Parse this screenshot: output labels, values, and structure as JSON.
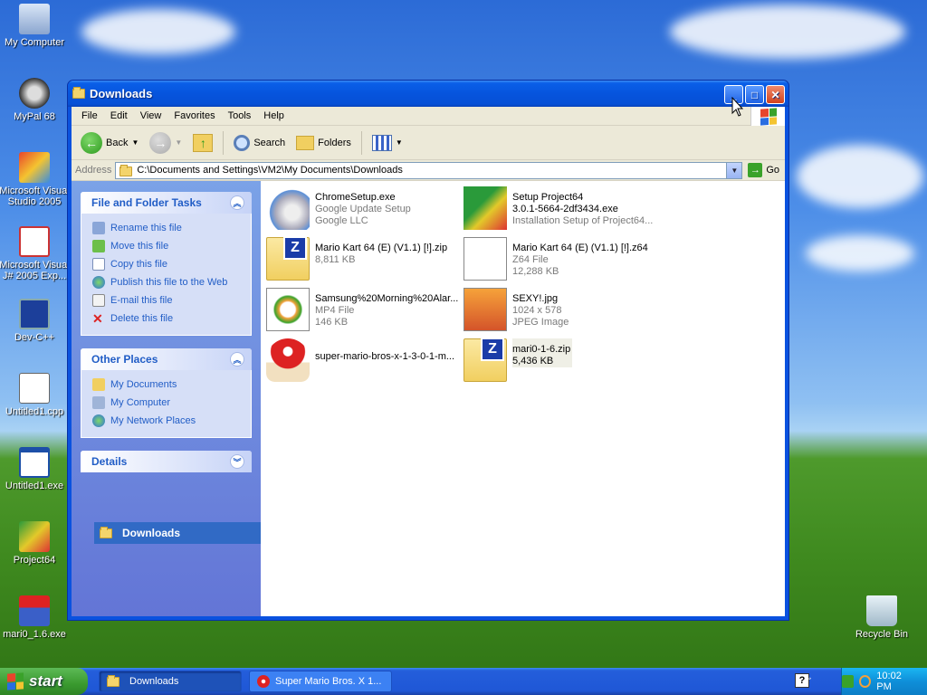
{
  "desktop": {
    "icons": [
      {
        "label": "My Computer"
      },
      {
        "label": "MyPal 68"
      },
      {
        "label": "Microsoft Visual Studio 2005"
      },
      {
        "label": "Microsoft Visual J# 2005 Exp..."
      },
      {
        "label": "Dev-C++"
      },
      {
        "label": "Untitled1.cpp"
      },
      {
        "label": "Untitled1.exe"
      },
      {
        "label": "Project64"
      },
      {
        "label": "mari0_1.6.exe"
      },
      {
        "label": "Recycle Bin"
      }
    ]
  },
  "window": {
    "title": "Downloads",
    "menu": [
      "File",
      "Edit",
      "View",
      "Favorites",
      "Tools",
      "Help"
    ],
    "toolbar": {
      "back": "Back",
      "search": "Search",
      "folders": "Folders"
    },
    "address": {
      "label": "Address",
      "value": "C:\\Documents and Settings\\VM2\\My Documents\\Downloads",
      "go": "Go"
    },
    "tasks": {
      "file_folder": {
        "title": "File and Folder Tasks",
        "items": [
          "Rename this file",
          "Move this file",
          "Copy this file",
          "Publish this file to the Web",
          "E-mail this file",
          "Delete this file"
        ]
      },
      "other_places": {
        "title": "Other Places",
        "items": [
          "My Documents",
          "My Computer",
          "My Network Places"
        ]
      },
      "details": {
        "title": "Details"
      }
    },
    "rename_box": "Downloads",
    "files": [
      {
        "name": "ChromeSetup.exe",
        "line2": "Google Update Setup",
        "line3": "Google LLC"
      },
      {
        "name": "Setup Project64",
        "line2": "3.0.1-5664-2df3434.exe",
        "line3": "Installation Setup of Project64..."
      },
      {
        "name": "Mario Kart 64 (E) (V1.1) [!].zip",
        "line2": "8,811 KB",
        "line3": ""
      },
      {
        "name": "Mario Kart 64 (E) (V1.1) [!].z64",
        "line2": "Z64 File",
        "line3": "12,288 KB"
      },
      {
        "name": "Samsung%20Morning%20Alar...",
        "line2": "MP4 File",
        "line3": "146 KB"
      },
      {
        "name": "SEXY!.jpg",
        "line2": "1024 x 578",
        "line3": "JPEG Image"
      },
      {
        "name": "super-mario-bros-x-1-3-0-1-m...",
        "line2": "",
        "line3": ""
      },
      {
        "name": "mari0-1-6.zip",
        "line2": "5,436 KB",
        "line3": ""
      }
    ]
  },
  "taskbar": {
    "start": "start",
    "tasks": [
      "Downloads",
      "Super Mario Bros. X 1..."
    ],
    "clock": "10:02 PM"
  }
}
